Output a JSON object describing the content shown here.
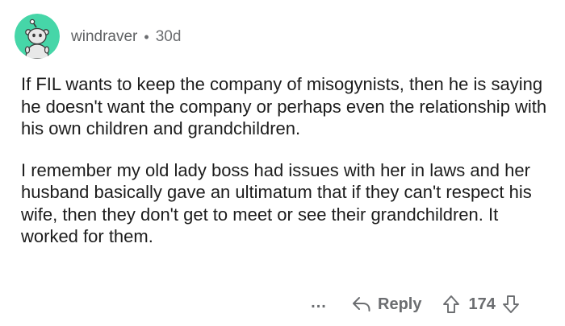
{
  "comment": {
    "author": "windraver",
    "separator": "•",
    "age": "30d",
    "paragraphs": [
      "If FIL wants to keep the company of misogynists, then he is saying he doesn't want the company or perhaps even the relationship with his own children and grandchildren.",
      "I remember my old lady boss had issues with her in laws and her husband basically gave an ultimatum that if they can't respect his wife, then they don't get to meet or see their grandchildren. It worked for them."
    ]
  },
  "actions": {
    "more_label": "...",
    "reply_label": "Reply",
    "score": "174"
  },
  "icons": {
    "avatar": "snoo-avatar-icon",
    "reply": "reply-arrow-icon",
    "upvote": "upvote-arrow-icon",
    "downvote": "downvote-arrow-icon"
  },
  "colors": {
    "avatar_bg": "#46d6a8",
    "meta_text": "#6b6d70",
    "body_text": "#1c1c1c"
  }
}
